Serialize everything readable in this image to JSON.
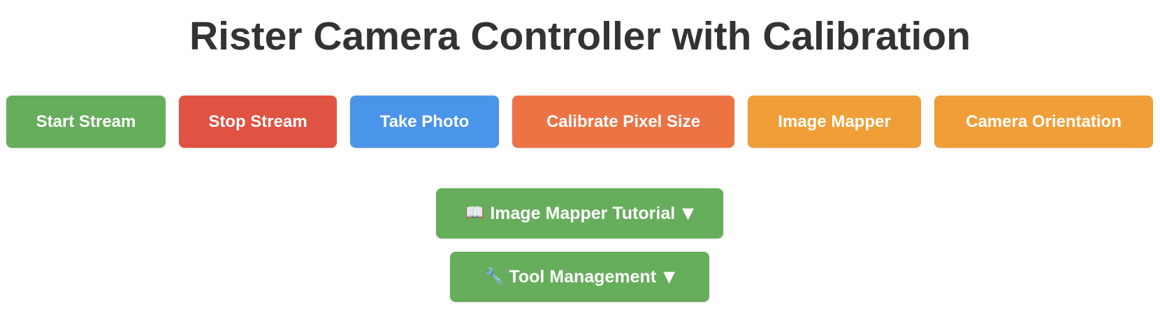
{
  "page": {
    "title": "Rister Camera Controller with Calibration"
  },
  "controls": {
    "start_stream": {
      "label": "Start Stream",
      "color": "#66ad5c"
    },
    "stop_stream": {
      "label": "Stop Stream",
      "color": "#e05242"
    },
    "take_photo": {
      "label": "Take Photo",
      "color": "#4a95ea"
    },
    "calibrate_pixel_size": {
      "label": "Calibrate Pixel Size",
      "color": "#ec7444"
    },
    "image_mapper": {
      "label": "Image Mapper",
      "color": "#f09f38"
    },
    "camera_orientation": {
      "label": "Camera Orientation",
      "color": "#f09f38"
    }
  },
  "toggles": {
    "image_mapper_tutorial": {
      "icon": "📖",
      "icon_name": "open-book-icon",
      "label": "Image Mapper Tutorial",
      "caret": "▼",
      "color": "#66ad5c"
    },
    "tool_management": {
      "icon": "🔧",
      "icon_name": "wrench-icon",
      "label": "Tool Management",
      "caret": "▼",
      "color": "#66ad5c"
    }
  }
}
